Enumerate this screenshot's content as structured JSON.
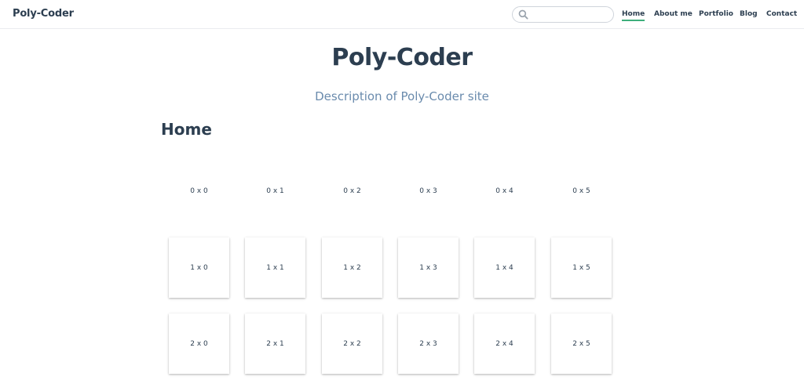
{
  "header": {
    "site_name": "Poly-Coder",
    "search": {
      "value": "",
      "placeholder": ""
    },
    "nav": [
      {
        "label": "Home",
        "active": true
      },
      {
        "label": "About me",
        "active": false
      },
      {
        "label": "Portfolio",
        "active": false
      },
      {
        "label": "Blog",
        "active": false
      },
      {
        "label": "Contact",
        "active": false
      }
    ]
  },
  "hero": {
    "title": "Poly-Coder",
    "description": "Description of Poly-Coder site"
  },
  "page": {
    "heading": "Home"
  },
  "grid": {
    "rows": [
      {
        "bordered": false,
        "cells": [
          "0 x 0",
          "0 x 1",
          "0 x 2",
          "0 x 3",
          "0 x 4",
          "0 x 5"
        ]
      },
      {
        "bordered": true,
        "cells": [
          "1 x 0",
          "1 x 1",
          "1 x 2",
          "1 x 3",
          "1 x 4",
          "1 x 5"
        ]
      },
      {
        "bordered": true,
        "cells": [
          "2 x 0",
          "2 x 1",
          "2 x 2",
          "2 x 3",
          "2 x 4",
          "2 x 5"
        ]
      }
    ]
  },
  "colors": {
    "accent": "#3eaf7c",
    "text": "#2c3e50",
    "description": "#6a8bad",
    "border": "#eaecef"
  }
}
